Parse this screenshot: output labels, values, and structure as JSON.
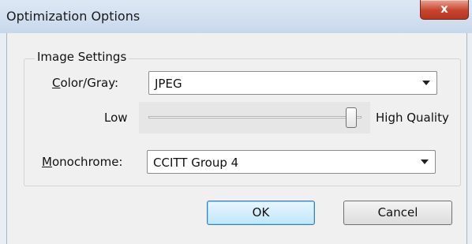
{
  "window": {
    "title": "Optimization Options",
    "close_label": "x"
  },
  "image_settings": {
    "group_label": "Image Settings",
    "color_gray": {
      "label_mnemonic": "C",
      "label_rest": "olor/Gray:",
      "value": "JPEG"
    },
    "quality": {
      "low_label": "Low",
      "high_label": "High Quality",
      "level_fraction": 1.0
    },
    "monochrome": {
      "label_mnemonic": "M",
      "label_rest": "onochrome:",
      "value": "CCITT Group 4"
    }
  },
  "buttons": {
    "ok": "OK",
    "cancel": "Cancel"
  }
}
